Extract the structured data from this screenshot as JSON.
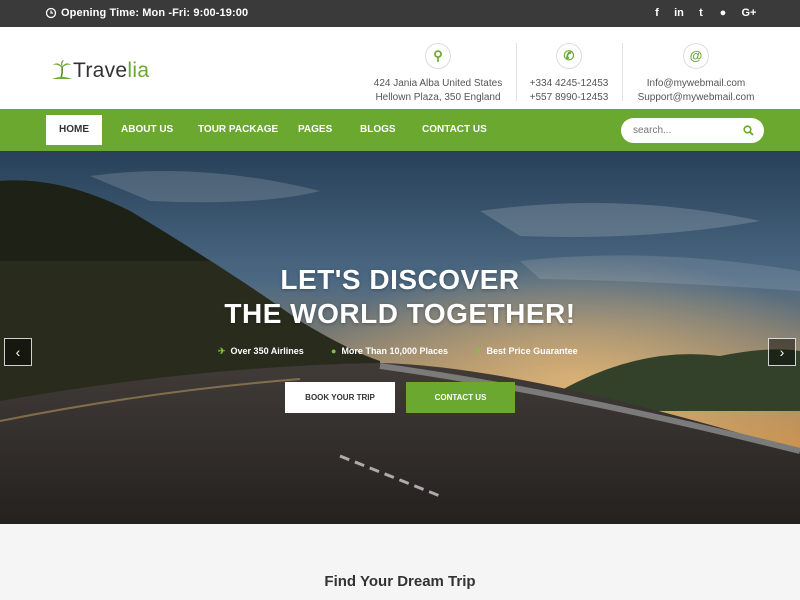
{
  "topbar": {
    "opening": "Opening Time: Mon -Fri: 9:00-19:00",
    "socials": [
      {
        "icon": "facebook-icon",
        "glyph": "f"
      },
      {
        "icon": "linkedin-icon",
        "glyph": "in"
      },
      {
        "icon": "twitter-icon",
        "glyph": "t"
      },
      {
        "icon": "reddit-icon",
        "glyph": "●"
      },
      {
        "icon": "google-plus-icon",
        "glyph": "G+"
      }
    ]
  },
  "header": {
    "logo_main": "Trave",
    "logo_accent": "lia",
    "contacts": [
      {
        "icon": "location-pin-icon",
        "glyph": "⚲",
        "line1": "424 Jania Alba United States",
        "line2": "Hellown Plaza, 350 England"
      },
      {
        "icon": "phone-icon",
        "glyph": "✆",
        "line1": "+334 4245-12453",
        "line2": "+557 8990-12453"
      },
      {
        "icon": "email-icon",
        "glyph": "@",
        "line1": "Info@mywebmail.com",
        "line2": "Support@mywebmail.com"
      }
    ]
  },
  "nav": {
    "items": [
      "HOME",
      "ABOUT US",
      "TOUR PACKAGE",
      "PAGES",
      "BLOGS",
      "CONTACT US"
    ],
    "active": "HOME",
    "search_placeholder": "search..."
  },
  "hero": {
    "title_line1": "LET'S DISCOVER",
    "title_line2": "THE WORLD TOGETHER!",
    "features": [
      {
        "icon": "plane-icon",
        "glyph": "✈",
        "text": "Over 350 Airlines"
      },
      {
        "icon": "map-marker-icon",
        "glyph": "●",
        "text": "More Than 10,000 Places"
      },
      {
        "icon": "check-icon",
        "glyph": "✔",
        "text": "Best Price Guarantee"
      }
    ],
    "book_label": "BOOK YOUR TRIP",
    "contact_label": "CONTACT US",
    "prev_glyph": "‹",
    "next_glyph": "›"
  },
  "section": {
    "title": "Find Your Dream Trip"
  },
  "colors": {
    "accent": "#6aa82f",
    "topbar": "#3a3a3a"
  }
}
